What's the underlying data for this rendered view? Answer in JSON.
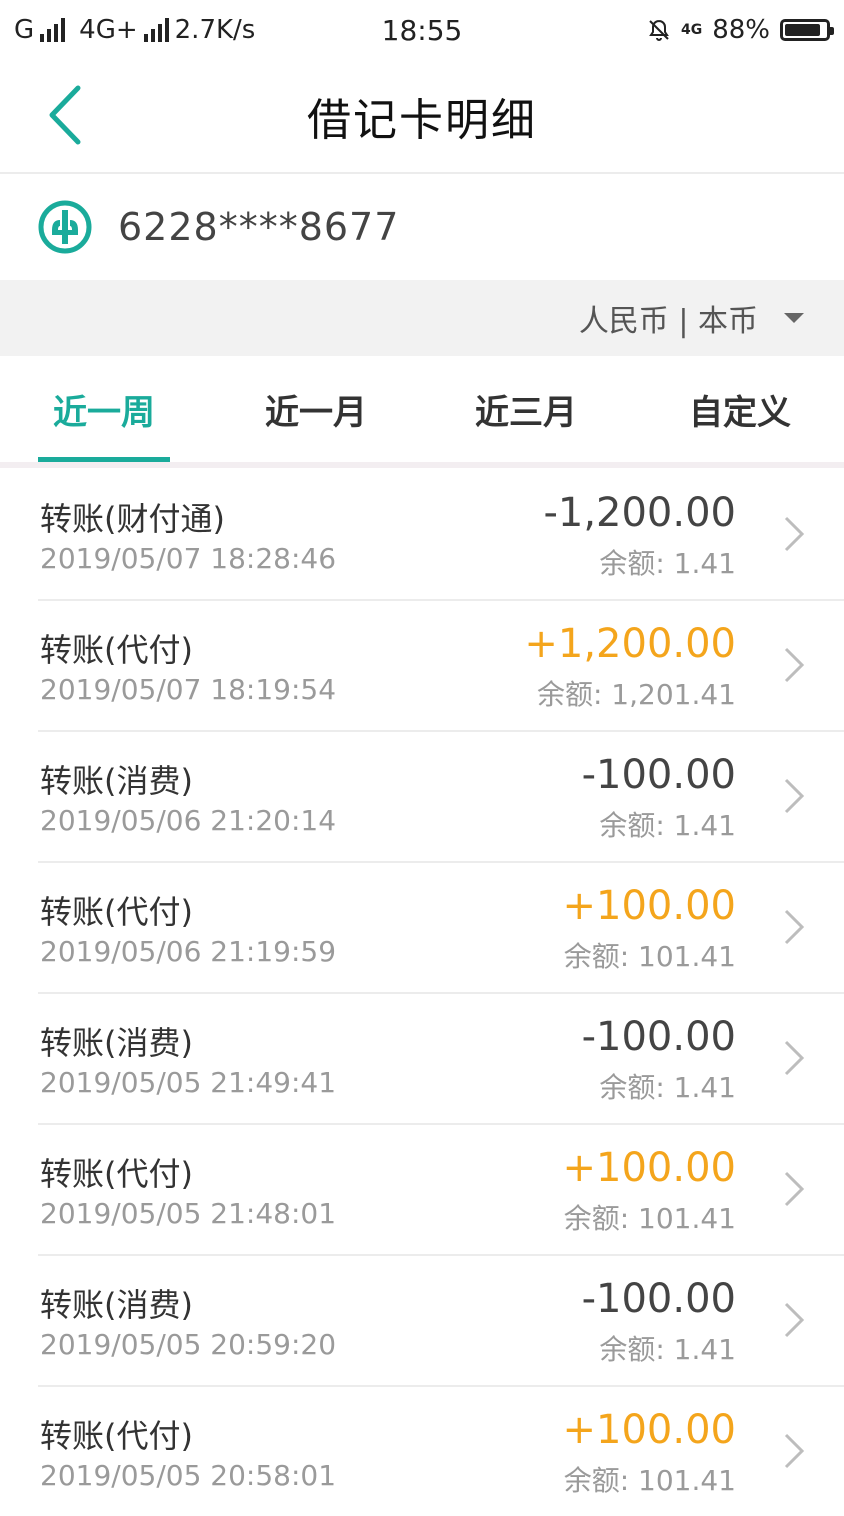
{
  "status_bar": {
    "carrier1": "G",
    "carrier2": "4G+",
    "speed": "2.7K/s",
    "time": "18:55",
    "net_badge": "4G",
    "battery": "88%",
    "battery_level": 0.88
  },
  "header": {
    "title": "借记卡明细"
  },
  "card": {
    "number": "6228****8677"
  },
  "currency": {
    "label": "人民币 | 本币"
  },
  "tabs": [
    {
      "label": "近一周",
      "active": true
    },
    {
      "label": "近一月",
      "active": false
    },
    {
      "label": "近三月",
      "active": false
    },
    {
      "label": "自定义",
      "active": false
    }
  ],
  "transactions": [
    {
      "title": "转账(财付通)",
      "time": "2019/05/07 18:28:46",
      "amount": "-1,200.00",
      "balance": "余额:  1.41",
      "positive": false
    },
    {
      "title": "转账(代付)",
      "time": "2019/05/07 18:19:54",
      "amount": "+1,200.00",
      "balance": "余额:  1,201.41",
      "positive": true
    },
    {
      "title": "转账(消费)",
      "time": "2019/05/06 21:20:14",
      "amount": "-100.00",
      "balance": "余额:  1.41",
      "positive": false
    },
    {
      "title": "转账(代付)",
      "time": "2019/05/06 21:19:59",
      "amount": "+100.00",
      "balance": "余额:  101.41",
      "positive": true
    },
    {
      "title": "转账(消费)",
      "time": "2019/05/05 21:49:41",
      "amount": "-100.00",
      "balance": "余额:  1.41",
      "positive": false
    },
    {
      "title": "转账(代付)",
      "time": "2019/05/05 21:48:01",
      "amount": "+100.00",
      "balance": "余额:  101.41",
      "positive": true
    },
    {
      "title": "转账(消费)",
      "time": "2019/05/05 20:59:20",
      "amount": "-100.00",
      "balance": "余额:  1.41",
      "positive": false
    },
    {
      "title": "转账(代付)",
      "time": "2019/05/05 20:58:01",
      "amount": "+100.00",
      "balance": "余额:  101.41",
      "positive": true
    }
  ],
  "colors": {
    "accent": "#1aab9b",
    "positive": "#f4a51c",
    "muted": "#9a9a9a"
  },
  "icons": {
    "back": "chevron-left-icon",
    "bank": "bank-logo-icon",
    "row": "chevron-right-icon"
  }
}
